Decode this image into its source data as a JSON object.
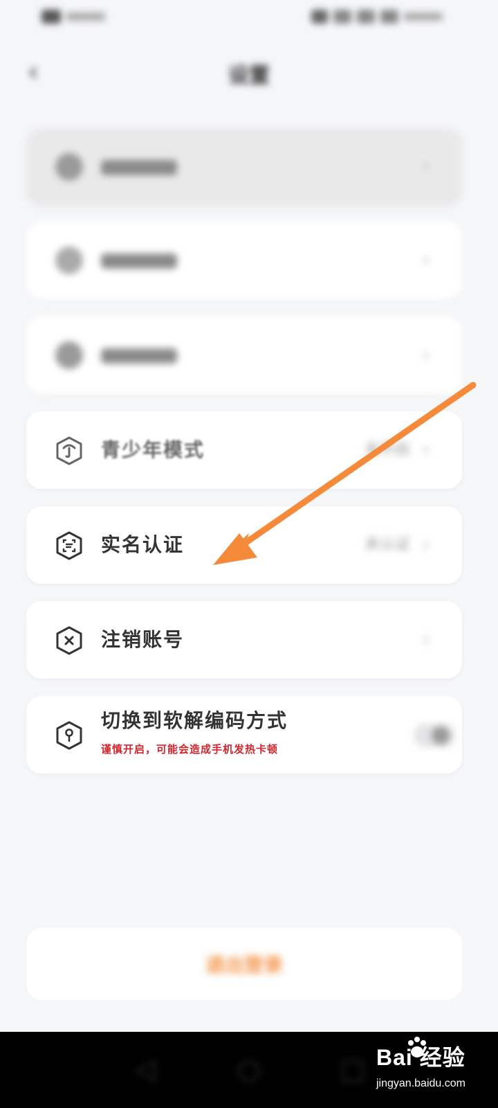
{
  "header": {
    "title": "设置",
    "back_icon": "chevron-left-icon"
  },
  "settings": {
    "youth_mode": {
      "label": "青少年模式",
      "value": "未开启",
      "icon": "shield-person-icon"
    },
    "real_name": {
      "label": "实名认证",
      "value": "未认证",
      "icon": "id-scan-icon"
    },
    "cancel_account": {
      "label": "注销账号",
      "icon": "close-hexagon-icon"
    },
    "soft_decoding": {
      "label": "切换到软解编码方式",
      "warning": "谨慎开启，可能会造成手机发热卡顿",
      "icon": "key-hexagon-icon"
    }
  },
  "footer": {
    "logout_label": "退出登录"
  },
  "watermark": {
    "brand": "Bai  经验",
    "site": "jingyan.baidu.com"
  },
  "colors": {
    "accent": "#f39244",
    "warning": "#d0262e",
    "arrow": "#f58a3a"
  }
}
